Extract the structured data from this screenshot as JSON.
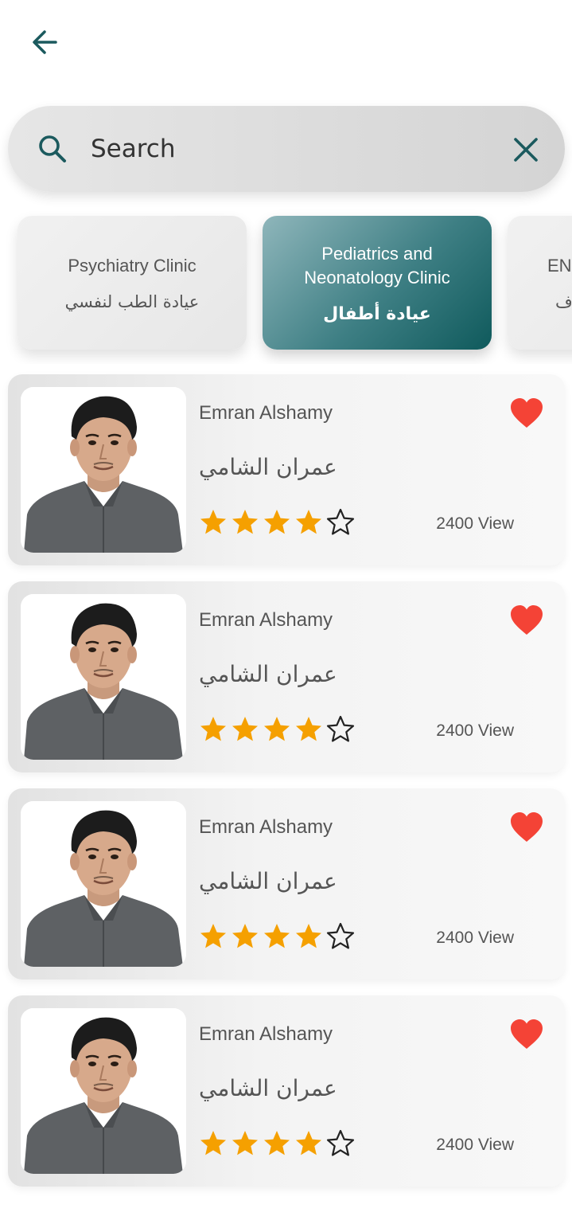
{
  "header": {
    "back_icon": "arrow-left-icon"
  },
  "search": {
    "placeholder": "Search",
    "value": "",
    "search_icon": "search-icon",
    "clear_icon": "close-icon"
  },
  "clinics": [
    {
      "name_en": "Psychiatry Clinic",
      "name_ar": "عيادة الطب لنفسي",
      "active": false
    },
    {
      "name_en": "Pediatrics and Neonatology Clinic",
      "name_ar": "عيادة أطفال",
      "active": true
    },
    {
      "name_en": "ENT",
      "name_ar": "ف",
      "active": false
    }
  ],
  "colors": {
    "accent": "#0f5a5c",
    "star": "#f5a000",
    "heart": "#f44336"
  },
  "doctors": [
    {
      "name_en": "Emran Alshamy",
      "name_ar": "عمران الشامي",
      "rating": 4,
      "max_rating": 5,
      "views": "2400 View",
      "favorite": true
    },
    {
      "name_en": "Emran Alshamy",
      "name_ar": "عمران الشامي",
      "rating": 4,
      "max_rating": 5,
      "views": "2400 View",
      "favorite": true
    },
    {
      "name_en": "Emran Alshamy",
      "name_ar": "عمران الشامي",
      "rating": 4,
      "max_rating": 5,
      "views": "2400 View",
      "favorite": true
    },
    {
      "name_en": "Emran Alshamy",
      "name_ar": "عمران الشامي",
      "rating": 4,
      "max_rating": 5,
      "views": "2400 View",
      "favorite": true
    }
  ]
}
